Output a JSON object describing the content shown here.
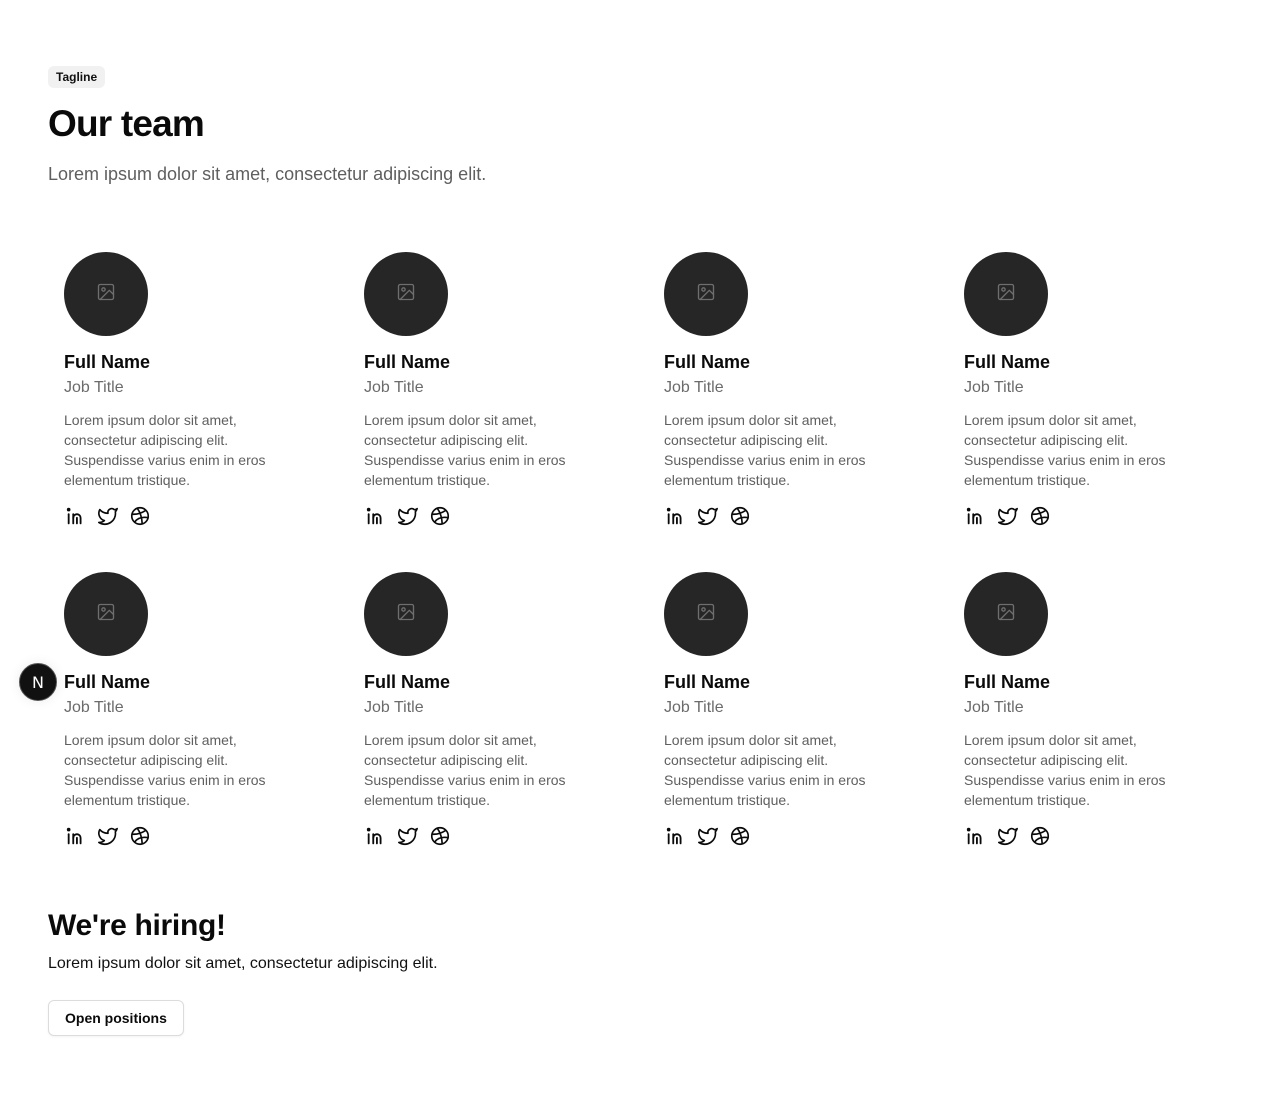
{
  "header": {
    "tagline": "Tagline",
    "title": "Our team",
    "intro": "Lorem ipsum dolor sit amet, consectetur adipiscing elit."
  },
  "members": [
    {
      "name": "Full Name",
      "title": "Job Title",
      "bio": "Lorem ipsum dolor sit amet, consectetur adipiscing elit. Suspendisse varius enim in eros elementum tristique."
    },
    {
      "name": "Full Name",
      "title": "Job Title",
      "bio": "Lorem ipsum dolor sit amet, consectetur adipiscing elit. Suspendisse varius enim in eros elementum tristique."
    },
    {
      "name": "Full Name",
      "title": "Job Title",
      "bio": "Lorem ipsum dolor sit amet, consectetur adipiscing elit. Suspendisse varius enim in eros elementum tristique."
    },
    {
      "name": "Full Name",
      "title": "Job Title",
      "bio": "Lorem ipsum dolor sit amet, consectetur adipiscing elit. Suspendisse varius enim in eros elementum tristique."
    },
    {
      "name": "Full Name",
      "title": "Job Title",
      "bio": "Lorem ipsum dolor sit amet, consectetur adipiscing elit. Suspendisse varius enim in eros elementum tristique."
    },
    {
      "name": "Full Name",
      "title": "Job Title",
      "bio": "Lorem ipsum dolor sit amet, consectetur adipiscing elit. Suspendisse varius enim in eros elementum tristique."
    },
    {
      "name": "Full Name",
      "title": "Job Title",
      "bio": "Lorem ipsum dolor sit amet, consectetur adipiscing elit. Suspendisse varius enim in eros elementum tristique."
    },
    {
      "name": "Full Name",
      "title": "Job Title",
      "bio": "Lorem ipsum dolor sit amet, consectetur adipiscing elit. Suspendisse varius enim in eros elementum tristique."
    }
  ],
  "socials": [
    "linkedin-icon",
    "twitter-icon",
    "dribbble-icon"
  ],
  "icons": {
    "avatar_placeholder": "image-placeholder-icon"
  },
  "floating_badge": {
    "label": "N"
  },
  "hiring": {
    "title": "We're hiring!",
    "text": "Lorem ipsum dolor sit amet, consectetur adipiscing elit.",
    "button_label": "Open positions"
  },
  "colors": {
    "avatar_bg": "#262626",
    "tagline_bg": "#f1f1f1",
    "text_primary": "#0a0a0a",
    "text_muted": "#5f5f5f"
  }
}
